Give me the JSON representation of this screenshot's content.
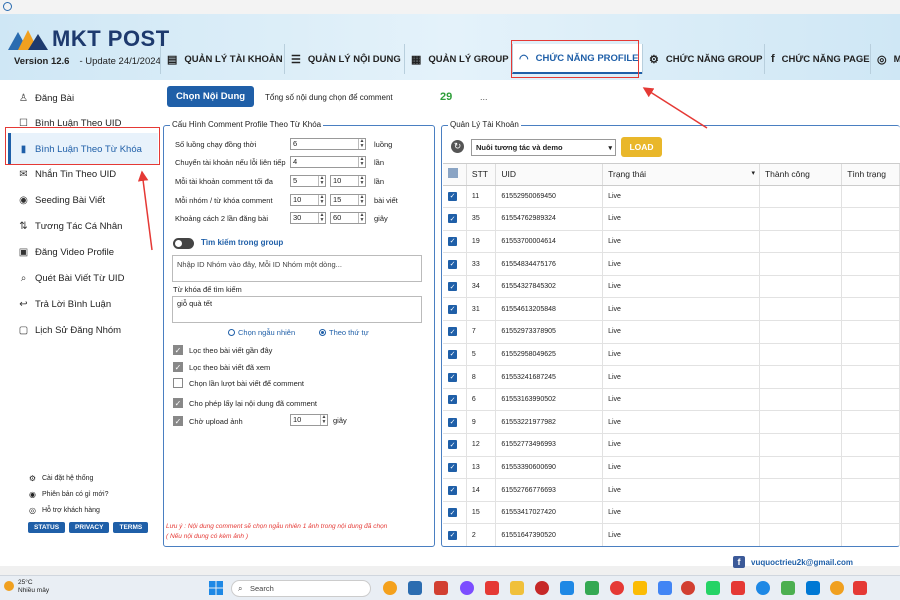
{
  "app": {
    "brand": "MKT POST",
    "version_label": "Version  12.6",
    "update_label": "- Update  24/1/2024"
  },
  "tabs": [
    {
      "label": "QUẢN LÝ TÀI KHOẢN",
      "icon": "account-card-icon"
    },
    {
      "label": "QUẢN LÝ NỘI DUNG",
      "icon": "list-icon"
    },
    {
      "label": "QUẢN LÝ GROUP",
      "icon": "group-icon"
    },
    {
      "label": "CHỨC NĂNG PROFILE",
      "icon": "wifi-signal-icon",
      "active": true
    },
    {
      "label": "CHỨC NĂNG GROUP",
      "icon": "settings-icon"
    },
    {
      "label": "CHỨC NĂNG PAGE",
      "icon": "facebook-icon"
    },
    {
      "label": "M",
      "icon": "messenger-icon"
    }
  ],
  "sidebar": {
    "items": [
      {
        "label": "Đăng Bài",
        "icon": "user-icon"
      },
      {
        "label": "Bình Luận Theo UID",
        "icon": "comment-icon"
      },
      {
        "label": "Bình Luận Theo Từ Khóa",
        "icon": "book-icon",
        "active": true
      },
      {
        "label": "Nhắn Tin Theo UID",
        "icon": "chat-icon"
      },
      {
        "label": "Seeding Bài Viết",
        "icon": "seed-icon"
      },
      {
        "label": "Tương Tác Cá Nhân",
        "icon": "swap-icon"
      },
      {
        "label": "Đăng Video Profile",
        "icon": "video-icon"
      },
      {
        "label": "Quét Bài Viết Từ UID",
        "icon": "scan-icon"
      },
      {
        "label": "Trả Lời Bình Luận",
        "icon": "reply-icon"
      },
      {
        "label": "Lịch Sử Đăng Nhóm",
        "icon": "history-icon"
      }
    ],
    "links": [
      {
        "label": "Cài đặt hệ thống",
        "icon": "gear-icon"
      },
      {
        "label": "Phiên bản có gì mới?",
        "icon": "new-icon"
      },
      {
        "label": "Hỗ trợ khách hàng",
        "icon": "support-icon"
      }
    ],
    "pills": [
      "STATUS",
      "PRIVACY",
      "TERMS"
    ]
  },
  "top": {
    "button": "Chọn Nội Dung",
    "total_label": "Tổng số nội dung chọn để comment",
    "total_value": "29",
    "dots": "..."
  },
  "config": {
    "title": "Cấu Hình Comment Profile Theo Từ Khóa",
    "rows": [
      {
        "label": "Số luồng chạy đồng thời",
        "v1": "6",
        "unit": "luồng"
      },
      {
        "label": "Chuyển tài khoản nếu lỗi liên tiếp",
        "v1": "4",
        "unit": "lần"
      },
      {
        "label": "Mỗi tài khoản comment tối đa",
        "v1": "5",
        "v2": "10",
        "unit": "lần"
      },
      {
        "label": "Mỗi nhóm / từ khóa comment",
        "v1": "10",
        "v2": "15",
        "unit": "bài viết"
      },
      {
        "label": "Khoảng cách 2 lần đăng bài",
        "v1": "30",
        "v2": "60",
        "unit": "giây"
      }
    ],
    "toggle_label": "Tìm kiếm trong group",
    "group_placeholder": "Nhập ID Nhóm vào đây, Mỗi ID Nhóm một dòng...",
    "keyword_label": "Từ khóa để tìm kiếm",
    "keyword_value": "giỗ quà tết",
    "radio_random": "Chọn ngẫu nhiên",
    "radio_order": "Theo thứ tự",
    "checks": [
      {
        "label": "Lọc theo bài viết gần đây",
        "checked": true
      },
      {
        "label": "Lọc theo bài viết đã xem",
        "checked": true
      },
      {
        "label": "Chọn lần lượt bài viết để comment",
        "checked": false
      },
      {
        "label": "Cho phép lấy lại nội dung đã comment",
        "checked": true
      },
      {
        "label": "Chờ upload ảnh",
        "checked": true
      }
    ],
    "upload_wait": "10",
    "upload_unit": "giây",
    "note1": "Lưu ý : Nội dung comment sẽ chọn ngẫu nhiên 1 ảnh trong nội dung đã chọn",
    "note2": "( Nếu nội dung có kèm ảnh )"
  },
  "accounts": {
    "title": "Quản Lý Tài Khoản",
    "select_value": "Nuôi tương  tác và demo",
    "load": "LOAD",
    "headers": {
      "stt": "STT",
      "uid": "UID",
      "status": "Trạng thái",
      "success": "Thành công",
      "state": "Tình trạng"
    },
    "rows": [
      {
        "stt": "11",
        "uid": "61552950069450",
        "status": "Live"
      },
      {
        "stt": "35",
        "uid": "61554762989324",
        "status": "Live"
      },
      {
        "stt": "19",
        "uid": "61553700004614",
        "status": "Live"
      },
      {
        "stt": "33",
        "uid": "61554834475176",
        "status": "Live"
      },
      {
        "stt": "34",
        "uid": "61554327845302",
        "status": "Live"
      },
      {
        "stt": "31",
        "uid": "61554613205848",
        "status": "Live"
      },
      {
        "stt": "7",
        "uid": "61552973378905",
        "status": "Live"
      },
      {
        "stt": "5",
        "uid": "61552958049625",
        "status": "Live"
      },
      {
        "stt": "8",
        "uid": "61553241687245",
        "status": "Live"
      },
      {
        "stt": "6",
        "uid": "61553163990502",
        "status": "Live"
      },
      {
        "stt": "9",
        "uid": "61553221977982",
        "status": "Live"
      },
      {
        "stt": "12",
        "uid": "61552773496993",
        "status": "Live"
      },
      {
        "stt": "13",
        "uid": "61553390600690",
        "status": "Live"
      },
      {
        "stt": "14",
        "uid": "61552766776693",
        "status": "Live"
      },
      {
        "stt": "15",
        "uid": "61553417027420",
        "status": "Live"
      },
      {
        "stt": "2",
        "uid": "61551647390520",
        "status": "Live"
      }
    ]
  },
  "footer": {
    "email": "vuquoctrieu2k@gmail.com"
  },
  "taskbar": {
    "temp": "25°C",
    "weather": "Nhiều mây",
    "search": "Search"
  }
}
